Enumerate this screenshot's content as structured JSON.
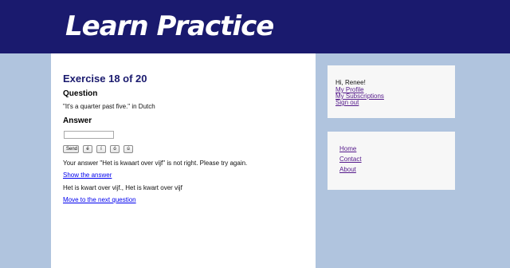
{
  "header": {
    "logo_text": "Learn Practice"
  },
  "exercise": {
    "title": "Exercise 18 of 20",
    "question_heading": "Question",
    "question_text": "\"It's a quarter past five.\" in Dutch",
    "answer_heading": "Answer",
    "answer_value": "",
    "buttons": {
      "send": "Send",
      "e_acute": "é",
      "i_acute": "í",
      "o_acute": "ó",
      "u_acute": "ú"
    },
    "feedback": "Your answer \"Het is kwaart over vijf\" is not right. Please try again.",
    "show_answer_link": "Show the answer",
    "correct_answers": "Het is kwart over vijf., Het is kwart over vijf",
    "next_question_link": "Move to the next question"
  },
  "user_box": {
    "greeting": "Hi, Renee!",
    "links": [
      "My Profile",
      "My Subscriptions",
      "Sign out"
    ]
  },
  "nav_box": {
    "links": [
      "Home",
      "Contact",
      "About"
    ]
  },
  "colors": {
    "header_bg": "#1a1a6e",
    "page_bg": "#b0c4de",
    "title_color": "#1a1a6e",
    "link_color": "#0000ee",
    "visited_link_color": "#551a8b"
  }
}
